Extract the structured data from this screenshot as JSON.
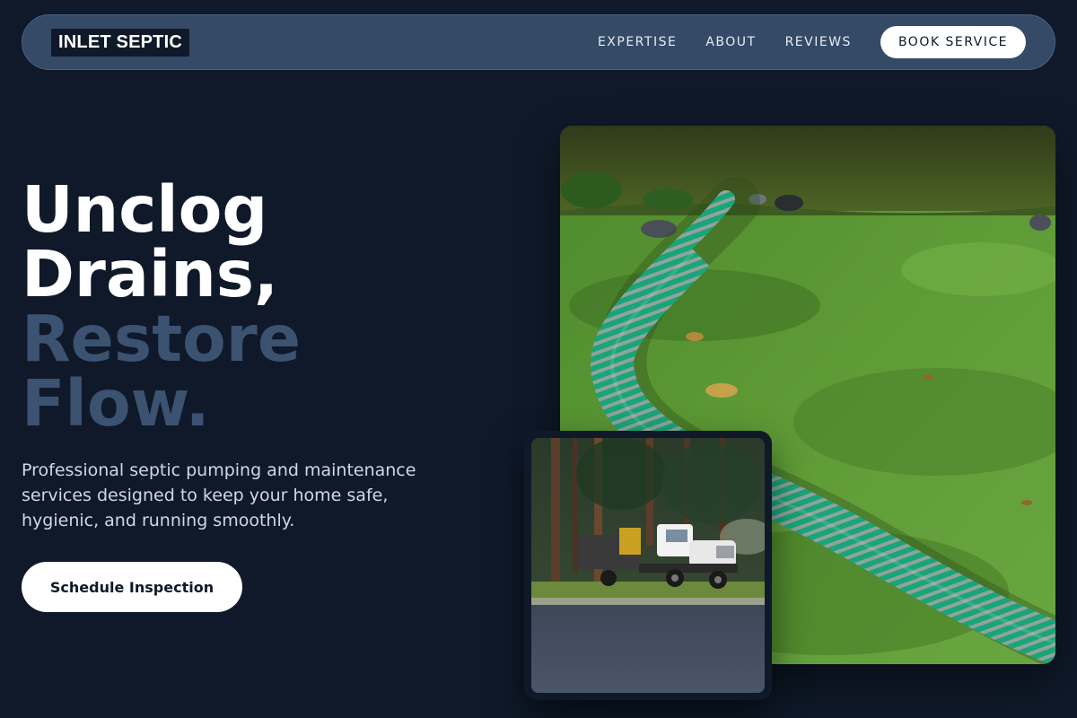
{
  "brand": {
    "name": "INLET SEPTIC"
  },
  "nav": {
    "links": [
      "EXPERTISE",
      "ABOUT",
      "REVIEWS"
    ],
    "cta": "BOOK SERVICE"
  },
  "hero": {
    "headline_line1": "Unclog",
    "headline_line2": "Drains,",
    "headline_line3": "Restore",
    "headline_line4": "Flow.",
    "subtext": "Professional septic pumping and maintenance services designed to keep your home safe, hygienic, and running smoothly.",
    "cta": "Schedule Inspection"
  },
  "images": {
    "main": "green-hose-on-lawn-photo",
    "secondary": "septic-truck-photo"
  },
  "colors": {
    "background": "#0f1929",
    "nav_bg": "#344a66",
    "muted_headline": "#3b5271",
    "white": "#ffffff"
  }
}
